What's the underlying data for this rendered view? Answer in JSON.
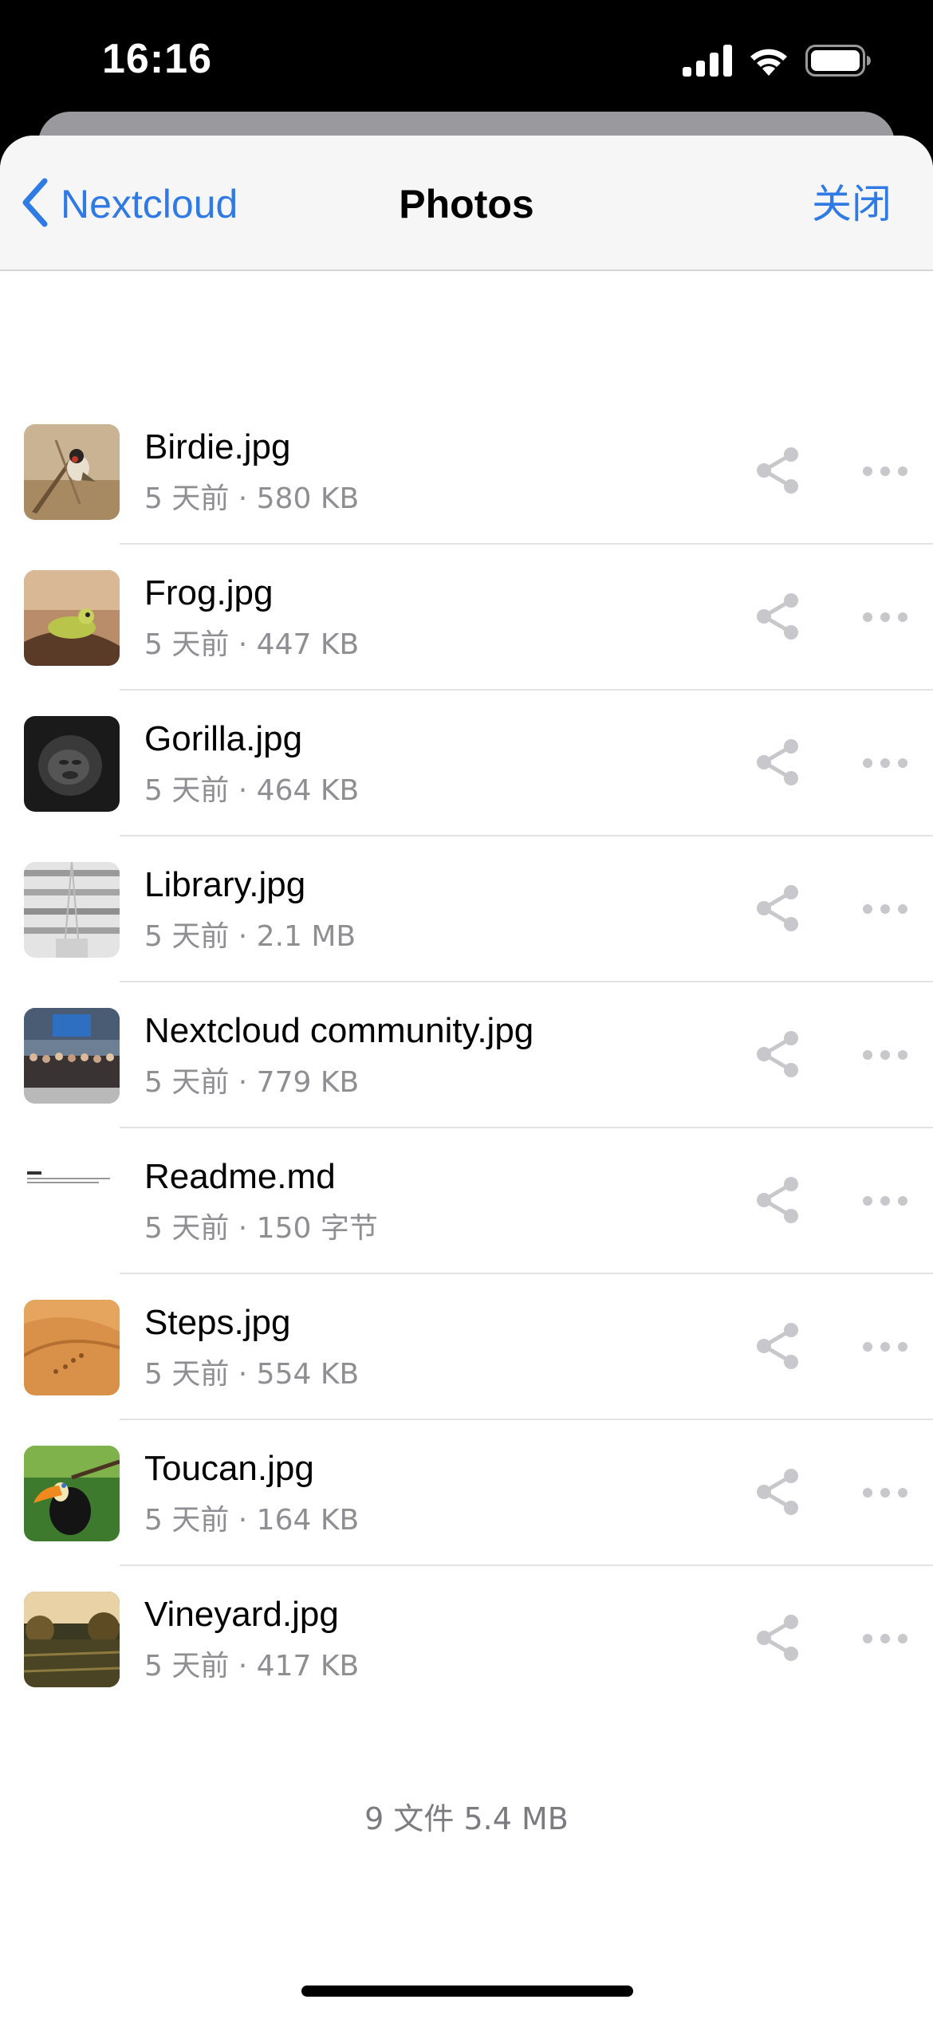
{
  "status_bar": {
    "time": "16:16",
    "icons": [
      "cellular-signal-icon",
      "wifi-icon",
      "battery-icon"
    ]
  },
  "nav": {
    "back_label": "Nextcloud",
    "title": "Photos",
    "close_label": "关闭"
  },
  "files": [
    {
      "name": "Birdie.jpg",
      "meta": "5 天前 · 580 KB",
      "thumb": "bird-photo"
    },
    {
      "name": "Frog.jpg",
      "meta": "5 天前 · 447 KB",
      "thumb": "frog-photo"
    },
    {
      "name": "Gorilla.jpg",
      "meta": "5 天前 · 464 KB",
      "thumb": "gorilla-photo"
    },
    {
      "name": "Library.jpg",
      "meta": "5 天前 · 2.1 MB",
      "thumb": "library-photo"
    },
    {
      "name": "Nextcloud community.jpg",
      "meta": "5 天前 · 779 KB",
      "thumb": "group-photo"
    },
    {
      "name": "Readme.md",
      "meta": "5 天前 · 150 字节",
      "thumb": "document-preview"
    },
    {
      "name": "Steps.jpg",
      "meta": "5 天前 · 554 KB",
      "thumb": "desert-photo"
    },
    {
      "name": "Toucan.jpg",
      "meta": "5 天前 · 164 KB",
      "thumb": "toucan-photo"
    },
    {
      "name": "Vineyard.jpg",
      "meta": "5 天前 · 417 KB",
      "thumb": "vineyard-photo"
    }
  ],
  "footer": {
    "summary": "9 文件  5.4 MB"
  },
  "colors": {
    "accent": "#2f7ae5",
    "secondary_text": "#8e8e93",
    "icon_gray": "#c7c7cc"
  }
}
